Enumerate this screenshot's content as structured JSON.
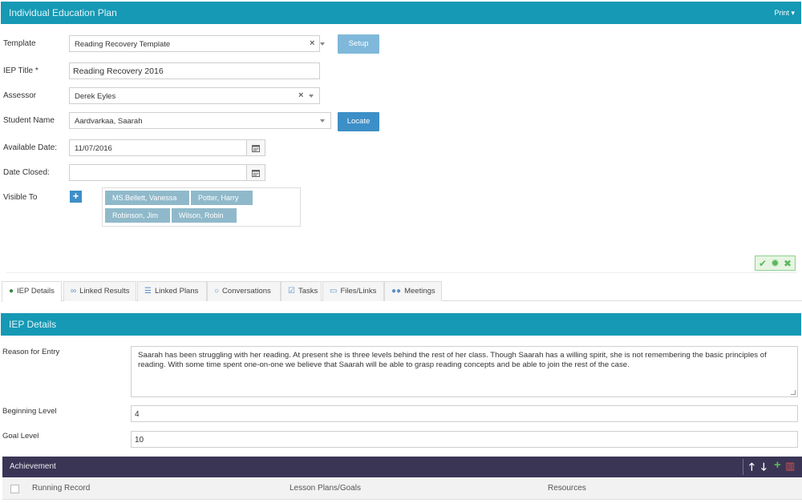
{
  "header": {
    "title": "Individual Education Plan",
    "print_label": "Print"
  },
  "form": {
    "template": {
      "label": "Template",
      "value": "Reading Recovery Template",
      "setup_label": "Setup"
    },
    "iep_title": {
      "label": "IEP Title *",
      "value": "Reading Recovery 2016"
    },
    "assessor": {
      "label": "Assessor",
      "value": "Derek Eyles"
    },
    "student": {
      "label": "Student Name",
      "value": "Aardvarkaa, Saarah",
      "locate_label": "Locate"
    },
    "available_date": {
      "label": "Available Date:",
      "value": "11/07/2016"
    },
    "date_closed": {
      "label": "Date Closed:",
      "value": ""
    },
    "visible_to": {
      "label": "Visible To",
      "add_symbol": "+",
      "chips": [
        "MS.Bellett, Vanessa",
        "Potter, Harry",
        "Robinson, Jim",
        "Wilson, Robin"
      ]
    }
  },
  "actions": {
    "confirm_icon": "check-icon",
    "settings_icon": "gear-icon",
    "cancel_icon": "close-icon"
  },
  "tabs": [
    {
      "label": "IEP Details",
      "icon": "user-icon",
      "active": true
    },
    {
      "label": "Linked Results",
      "icon": "link-icon"
    },
    {
      "label": "Linked Plans",
      "icon": "list-icon"
    },
    {
      "label": "Conversations",
      "icon": "comment-icon"
    },
    {
      "label": "Tasks",
      "icon": "checkbox-icon"
    },
    {
      "label": "Files/Links",
      "icon": "folder-icon"
    },
    {
      "label": "Meetings",
      "icon": "group-icon"
    }
  ],
  "details": {
    "section_title": "IEP Details",
    "reason_label": "Reason for Entry",
    "reason_value": "Saarah has been struggling with her reading. At present she is three levels behind the rest of her class. Though Saarah has a willing spirit, she is not remembering the basic principles of reading. With some time spent one-on-one we believe that Saarah will be able to grasp reading concepts and be able to join the rest of the case.",
    "beginning_label": "Beginning Level",
    "beginning_value": "4",
    "goal_label": "Goal Level",
    "goal_value": "10"
  },
  "achievement": {
    "title": "Achievement",
    "columns": [
      "Running Record",
      "Lesson Plans/Goals",
      "Resources"
    ],
    "colors": {
      "bar": "#3a3555",
      "add": "#5cb85c",
      "delete": "#d9534f"
    }
  },
  "colors": {
    "header": "#1599b4",
    "primary_button": "#3d8fc7",
    "chip": "#8fb9ca"
  }
}
